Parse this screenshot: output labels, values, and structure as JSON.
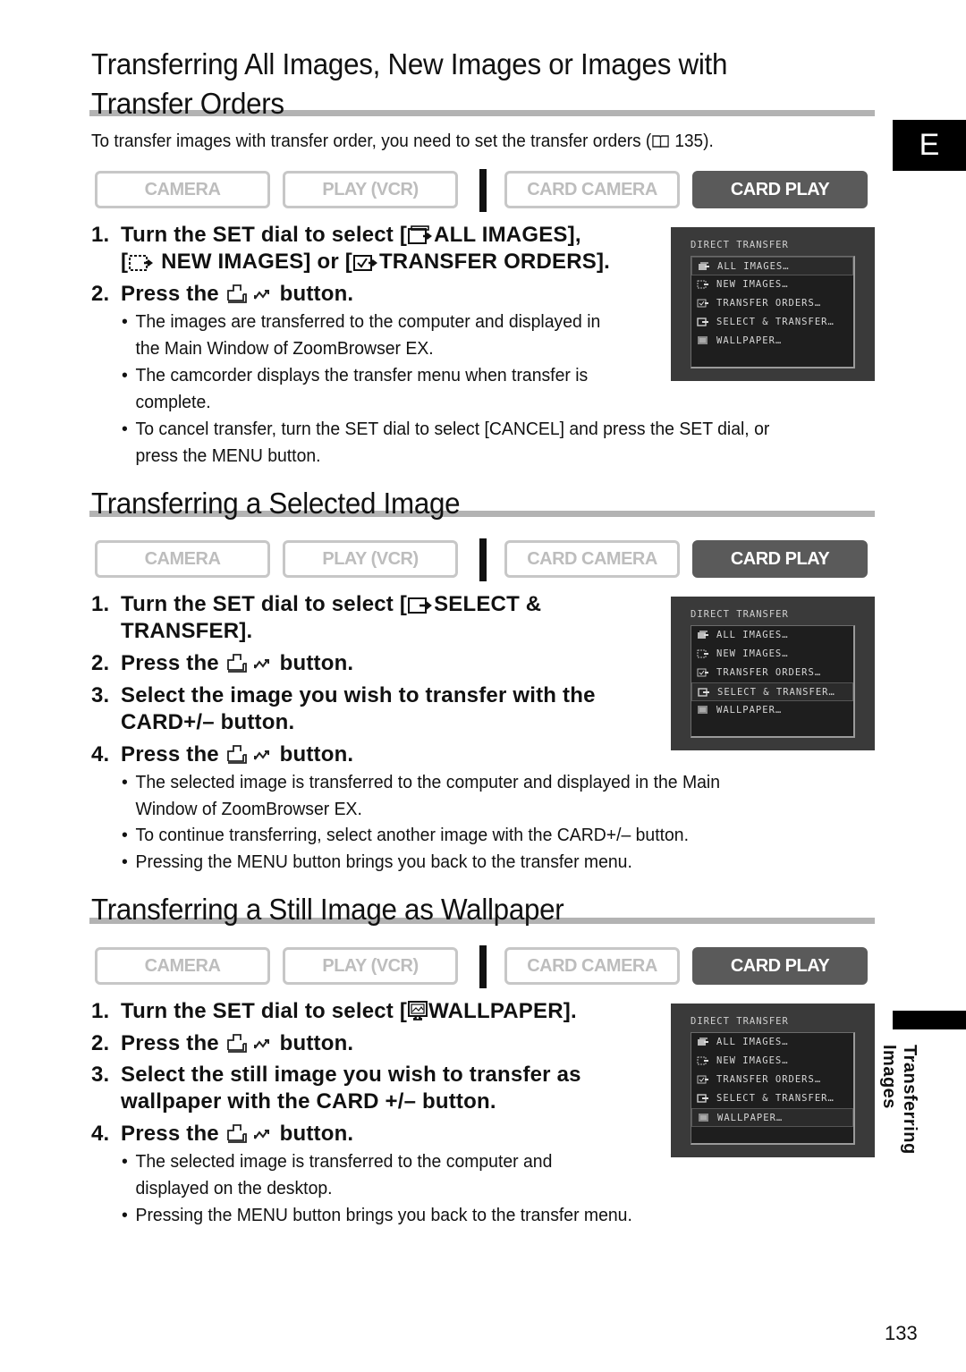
{
  "side_tab": {
    "language": "E",
    "chapter": "Transferring Images"
  },
  "page_number": "133",
  "mode_buttons": {
    "camera": "CAMERA",
    "play_vcr": "PLAY (VCR)",
    "card_camera": "CARD CAMERA",
    "card_play": "CARD PLAY",
    "active": "CARD PLAY"
  },
  "lcd_menu": {
    "title": "DIRECT TRANSFER",
    "items": [
      "ALL IMAGES…",
      "NEW IMAGES…",
      "TRANSFER ORDERS…",
      "SELECT & TRANSFER…",
      "WALLPAPER…"
    ]
  },
  "sections": [
    {
      "title_line1": "Transferring All Images, New Images or Images with",
      "title_line2": "Transfer Orders",
      "intro_prefix": "To transfer images with transfer order, you need to set the transfer orders (",
      "intro_ref": "135).",
      "lcd_selected": "ALL IMAGES…",
      "steps": [
        {
          "num": "1.",
          "pre": "Turn the SET dial to select [",
          "opt1": "ALL IMAGES],",
          "line2_pre": "[",
          "opt2": "NEW IMAGES] or [",
          "opt3": "TRANSFER ORDERS]."
        },
        {
          "num": "2.",
          "pre": "Press the",
          "post": "button."
        }
      ],
      "bullets": [
        [
          "The images are transferred to the computer and displayed in",
          "the Main Window of ZoomBrowser EX."
        ],
        [
          "The camcorder displays the transfer menu when transfer is",
          "complete."
        ],
        [
          "To cancel transfer, turn the SET dial to select [CANCEL] and press the SET dial, or",
          "press the MENU button."
        ]
      ]
    },
    {
      "title": "Transferring a Selected Image",
      "lcd_selected": "SELECT & TRANSFER…",
      "steps": [
        {
          "num": "1.",
          "pre": "Turn the SET dial to select [",
          "opt": "SELECT &",
          "line2": "TRANSFER]."
        },
        {
          "num": "2.",
          "pre": "Press the",
          "post": "button."
        },
        {
          "num": "3.",
          "line1": "Select the image you wish to transfer with the",
          "line2": "CARD+/– button."
        },
        {
          "num": "4.",
          "pre": "Press the",
          "post": "button."
        }
      ],
      "bullets": [
        [
          "The selected image is transferred to the computer and displayed in the Main",
          "Window of ZoomBrowser EX."
        ],
        [
          "To continue transferring, select another image with the CARD+/– button."
        ],
        [
          "Pressing the MENU button brings you back to the transfer menu."
        ]
      ]
    },
    {
      "title": "Transferring a Still Image as Wallpaper",
      "lcd_selected": "WALLPAPER…",
      "steps": [
        {
          "num": "1.",
          "pre": "Turn the SET dial to select [",
          "opt": "WALLPAPER]."
        },
        {
          "num": "2.",
          "pre": "Press the",
          "post": "button."
        },
        {
          "num": "3.",
          "line1": "Select the still image you wish to transfer as",
          "line2": "wallpaper with the CARD +/– button."
        },
        {
          "num": "4.",
          "pre": "Press the",
          "post": "button."
        }
      ],
      "bullets": [
        [
          "The selected image is transferred to the computer and",
          "displayed on the desktop."
        ],
        [
          "Pressing the MENU button brings you back to the transfer menu."
        ]
      ]
    }
  ]
}
